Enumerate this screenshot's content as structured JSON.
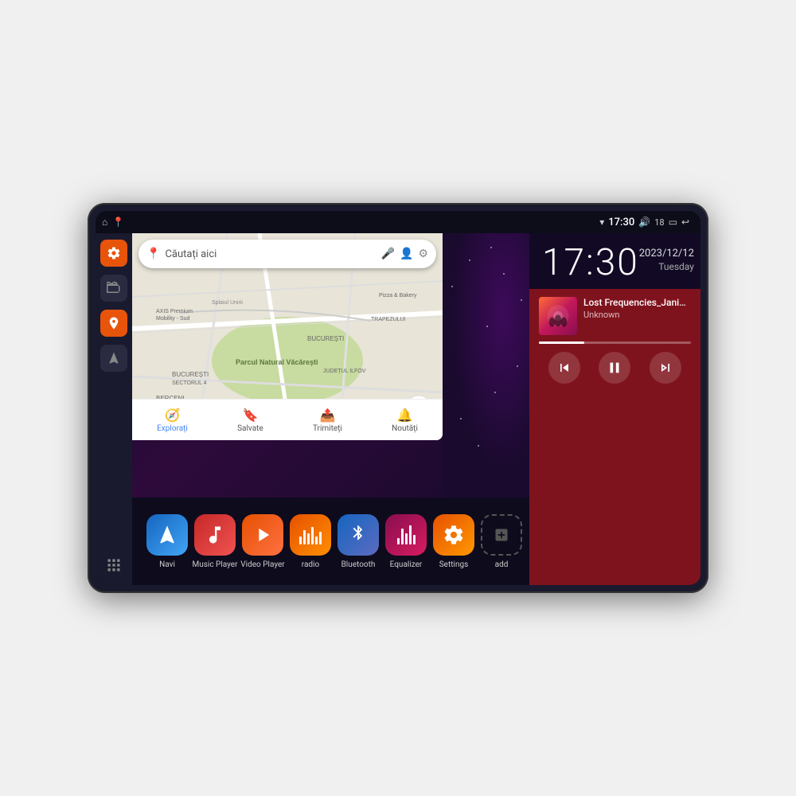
{
  "device": {
    "status_bar": {
      "left_icons": [
        "home",
        "location"
      ],
      "wifi_icon": "wifi",
      "time": "17:30",
      "volume_icon": "volume",
      "battery_number": "18",
      "battery_icon": "battery",
      "back_icon": "back"
    },
    "clock": {
      "time": "17:30",
      "date": "2023/12/12",
      "day": "Tuesday"
    },
    "music": {
      "title": "Lost Frequencies_Janie...",
      "artist": "Unknown",
      "progress": 30
    },
    "map": {
      "search_placeholder": "Căutați aici",
      "locations": [
        "AXIS Premium Mobility - Sud",
        "Pizza & Bakery",
        "Parcul Natural Văcărești",
        "BUCUREȘTI",
        "BUCUREȘTI SECTORUL 4",
        "BERCENI",
        "JUDEȚUL ILFOV",
        "TRAPEZULUI"
      ],
      "bottom_items": [
        {
          "label": "Explorați",
          "icon": "🧭"
        },
        {
          "label": "Salvate",
          "icon": "🔖"
        },
        {
          "label": "Trimiteți",
          "icon": "📤"
        },
        {
          "label": "Noutăți",
          "icon": "🔔"
        }
      ]
    },
    "sidebar": {
      "icons": [
        {
          "name": "settings",
          "color": "orange"
        },
        {
          "name": "archive",
          "color": "dark"
        },
        {
          "name": "location",
          "color": "orange"
        },
        {
          "name": "navigation",
          "color": "dark"
        }
      ],
      "bottom": "grid"
    },
    "apps": [
      {
        "id": "navi",
        "label": "Navi",
        "icon": "navi",
        "color": "icon-navi"
      },
      {
        "id": "music-player",
        "label": "Music Player",
        "icon": "music",
        "color": "icon-music"
      },
      {
        "id": "video-player",
        "label": "Video Player",
        "icon": "video",
        "color": "icon-video"
      },
      {
        "id": "radio",
        "label": "radio",
        "icon": "radio",
        "color": "icon-radio"
      },
      {
        "id": "bluetooth",
        "label": "Bluetooth",
        "icon": "bt",
        "color": "icon-bt"
      },
      {
        "id": "equalizer",
        "label": "Equalizer",
        "icon": "eq",
        "color": "icon-eq"
      },
      {
        "id": "settings-app",
        "label": "Settings",
        "icon": "settings",
        "color": "icon-settings"
      },
      {
        "id": "add",
        "label": "add",
        "icon": "plus",
        "color": "icon-add"
      }
    ]
  }
}
